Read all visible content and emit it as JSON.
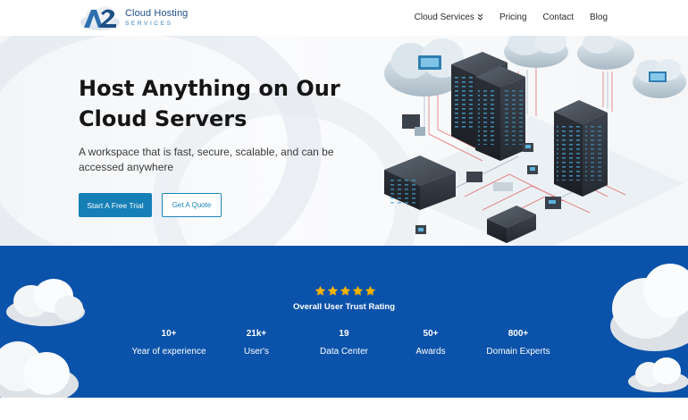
{
  "brand": {
    "name_line1": "Cloud Hosting",
    "name_line2": "SERVICES",
    "logo_mark": "A2"
  },
  "nav": {
    "items": [
      {
        "label": "Cloud Services",
        "has_dropdown": true
      },
      {
        "label": "Pricing"
      },
      {
        "label": "Contact"
      },
      {
        "label": "Blog"
      }
    ]
  },
  "hero": {
    "title": "Host Anything on Our Cloud Servers",
    "subtitle": "A workspace that is fast, secure, scalable, and can be accessed anywhere",
    "primary_button": "Start A Free Trial",
    "secondary_button": "Get A Quote"
  },
  "trust": {
    "rating_stars": 5,
    "label": "Overall User Trust Rating"
  },
  "stats": [
    {
      "value": "10+",
      "label": "Year of experience"
    },
    {
      "value": "21k+",
      "label": "User's"
    },
    {
      "value": "19",
      "label": "Data Center"
    },
    {
      "value": "50+",
      "label": "Awards"
    },
    {
      "value": "800+",
      "label": "Domain Experts"
    }
  ],
  "colors": {
    "primary": "#157fb6",
    "stats_background": "#0b52aa",
    "star": "#f5b301",
    "logo_text": "#1f4f8a"
  },
  "icons": {
    "dropdown": "chevron-double-down-icon",
    "star": "star-icon"
  }
}
